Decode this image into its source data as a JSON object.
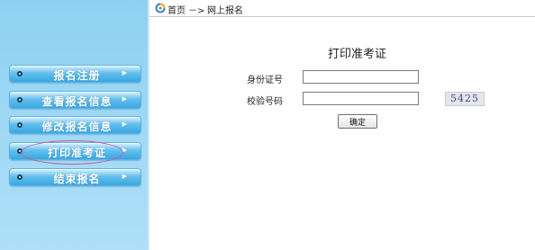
{
  "breadcrumb": {
    "home": "首页",
    "separator": "－>",
    "current": "网上报名",
    "home_icon": "home-icon"
  },
  "sidebar": {
    "items": [
      {
        "label": "报名注册",
        "arrow": "▶"
      },
      {
        "label": "查看报名信息",
        "arrow": "▶"
      },
      {
        "label": "修改报名信息",
        "arrow": "▶"
      },
      {
        "label": "打印准考证",
        "arrow": "▶",
        "highlighted": true
      },
      {
        "label": "结束报名",
        "arrow": "▶"
      }
    ]
  },
  "form": {
    "title": "打印准考证",
    "id_label": "身份证号",
    "id_value": "",
    "code_label": "校验号码",
    "code_value": "",
    "captcha": "5425",
    "submit_label": "确定"
  },
  "colors": {
    "sidebar_bg": "#8fd0f2",
    "nav_button": "#3aa6e0",
    "highlight_oval": "#c85a9a"
  }
}
